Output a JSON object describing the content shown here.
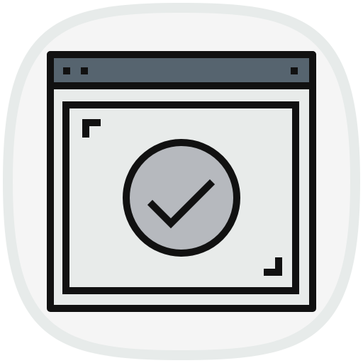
{
  "icon": {
    "name": "browser-window-verified-icon",
    "titlebar_dots": [
      "window-dot",
      "window-dot",
      "window-dot"
    ],
    "check_symbol": "checkmark-icon",
    "focus_corners": [
      "top-left-corner-bracket",
      "bottom-right-corner-bracket"
    ]
  },
  "colors": {
    "tile_outer": "#e7ebea",
    "tile_inner": "#f5f5f5",
    "outline": "#111111",
    "titlebar": "#56646f",
    "window_body": "#e8ebea",
    "check_circle": "#b6b9be"
  }
}
